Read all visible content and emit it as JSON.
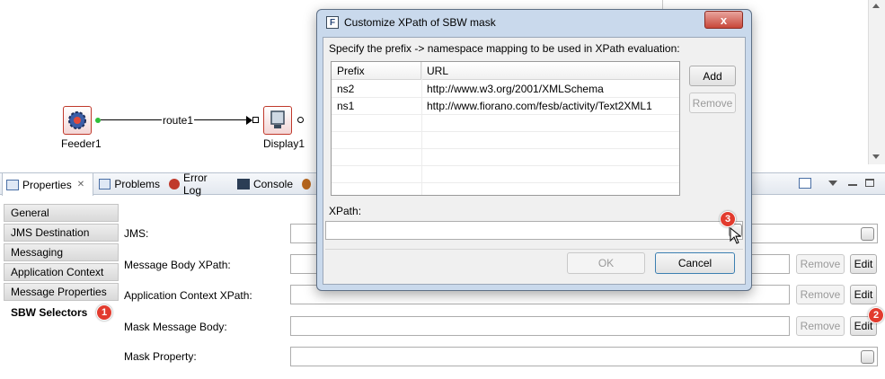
{
  "canvas": {
    "nodes": [
      {
        "label": "Feeder1"
      },
      {
        "label": "Display1"
      }
    ],
    "route_label": "route1"
  },
  "tabs": [
    {
      "label": "Properties"
    },
    {
      "label": "Problems"
    },
    {
      "label": "Error Log"
    },
    {
      "label": "Console"
    }
  ],
  "properties": {
    "nav": [
      {
        "label": "General"
      },
      {
        "label": "JMS Destination"
      },
      {
        "label": "Messaging"
      },
      {
        "label": "Application Context"
      },
      {
        "label": "Message Properties"
      },
      {
        "label": "SBW Selectors"
      }
    ],
    "fields": {
      "jms_label": "JMS:",
      "message_body_xpath_label": "Message Body XPath:",
      "app_context_xpath_label": "Application Context XPath:",
      "mask_message_body_label": "Mask Message Body:",
      "mask_property_label": "Mask Property:"
    },
    "remove_label": "Remove",
    "edit_label": "Edit"
  },
  "badges": {
    "one": "1",
    "two": "2",
    "three": "3"
  },
  "dialog": {
    "title": "Customize XPath of SBW mask",
    "instruction": "Specify the prefix -> namespace mapping to be used in XPath evaluation:",
    "columns": {
      "prefix": "Prefix",
      "url": "URL"
    },
    "rows": [
      {
        "prefix": "ns2",
        "url": "http://www.w3.org/2001/XMLSchema"
      },
      {
        "prefix": "ns1",
        "url": "http://www.fiorano.com/fesb/activity/Text2XML1"
      }
    ],
    "add_label": "Add",
    "remove_label": "Remove",
    "xpath_label": "XPath:",
    "ok_label": "OK",
    "cancel_label": "Cancel",
    "close_glyph": "x"
  },
  "colors": {
    "accent_badge": "#e23b2e",
    "dialog_frame": "#c9d9ec"
  }
}
